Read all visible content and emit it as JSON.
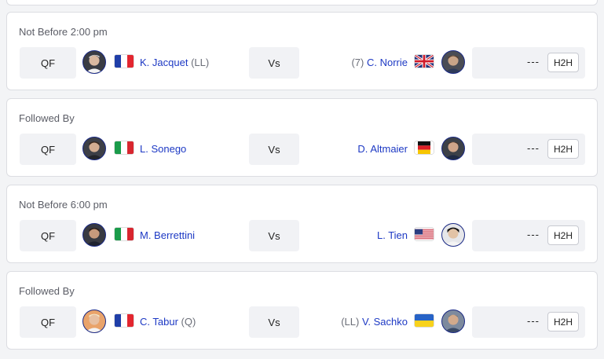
{
  "matches": [
    {
      "time_label": "Not Before 2:00 pm",
      "round": "QF",
      "vs": "Vs",
      "score": "---",
      "h2h": "H2H",
      "p1": {
        "seed": "",
        "name": "K. Jacquet",
        "suffix": "(LL)",
        "flag": "fr"
      },
      "p2": {
        "seed": "(7)",
        "name": "C. Norrie",
        "suffix": "",
        "flag": "gb"
      }
    },
    {
      "time_label": "Followed By",
      "round": "QF",
      "vs": "Vs",
      "score": "---",
      "h2h": "H2H",
      "p1": {
        "seed": "",
        "name": "L. Sonego",
        "suffix": "",
        "flag": "it"
      },
      "p2": {
        "seed": "",
        "name": "D. Altmaier",
        "suffix": "",
        "flag": "de"
      }
    },
    {
      "time_label": "Not Before 6:00 pm",
      "round": "QF",
      "vs": "Vs",
      "score": "---",
      "h2h": "H2H",
      "p1": {
        "seed": "",
        "name": "M. Berrettini",
        "suffix": "",
        "flag": "it"
      },
      "p2": {
        "seed": "",
        "name": "L. Tien",
        "suffix": "",
        "flag": "us"
      }
    },
    {
      "time_label": "Followed By",
      "round": "QF",
      "vs": "Vs",
      "score": "---",
      "h2h": "H2H",
      "p1": {
        "seed": "",
        "name": "C. Tabur",
        "suffix": "(Q)",
        "flag": "fr"
      },
      "p2": {
        "seed": "(LL)",
        "name": "V. Sachko",
        "suffix": "",
        "flag": "ua"
      }
    }
  ],
  "colors": {
    "link": "#1d39c4",
    "avatar_border": "#1a2a8a",
    "box": "#f1f2f5"
  }
}
